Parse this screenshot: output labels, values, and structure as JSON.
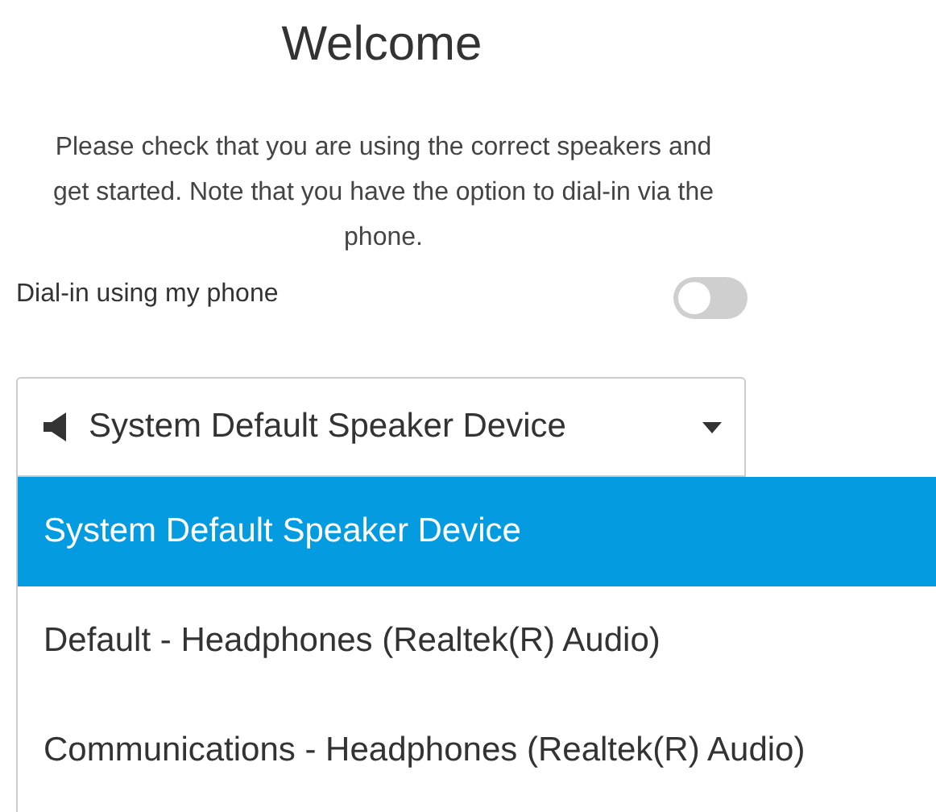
{
  "title": "Welcome",
  "intro": "Please check that you are using the correct speakers and get started. Note that you have the option to dial-in via the phone.",
  "dial_in": {
    "label": "Dial-in using my phone",
    "on": false
  },
  "speaker_select": {
    "value": "System Default Speaker Device",
    "expanded": true
  },
  "options": [
    {
      "label": "System Default Speaker Device",
      "selected": true
    },
    {
      "label": "Default - Headphones (Realtek(R) Audio)",
      "selected": false
    },
    {
      "label": "Communications - Headphones (Realtek(R) Audio)",
      "selected": false
    }
  ]
}
